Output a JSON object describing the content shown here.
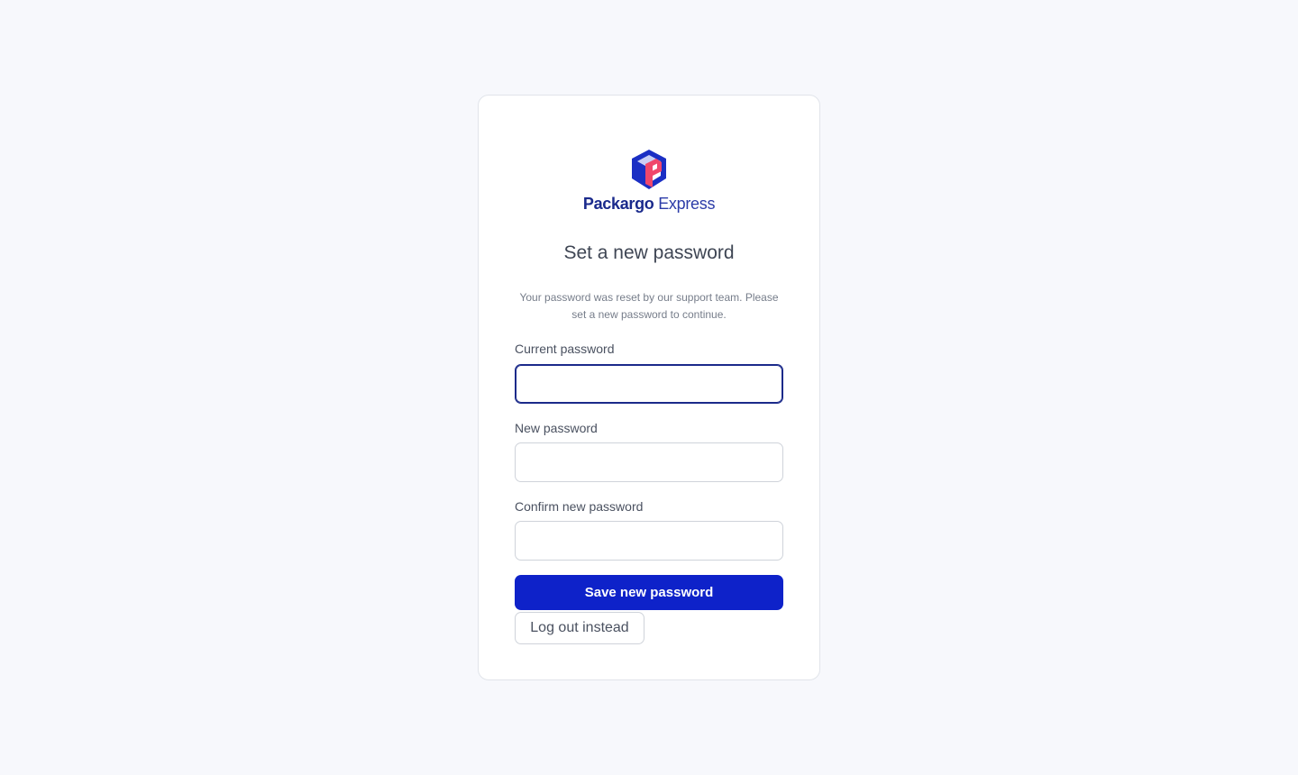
{
  "brand": {
    "name_strong": "Packargo",
    "name_light": " Express",
    "logo_icon": "packargo-box-logo",
    "colors": {
      "primary": "#1a2a8c",
      "accent": "#f0476b"
    }
  },
  "form": {
    "title": "Set a new password",
    "subtitle": "Your password was reset by our support team. Please set a new password to continue.",
    "fields": [
      {
        "label": "Current password",
        "value": "",
        "placeholder": ""
      },
      {
        "label": "New password",
        "value": "",
        "placeholder": ""
      },
      {
        "label": "Confirm new password",
        "value": "",
        "placeholder": ""
      }
    ],
    "submit_label": "Save new password",
    "logout_label": "Log out instead",
    "primary_color": "#0e22c9"
  }
}
